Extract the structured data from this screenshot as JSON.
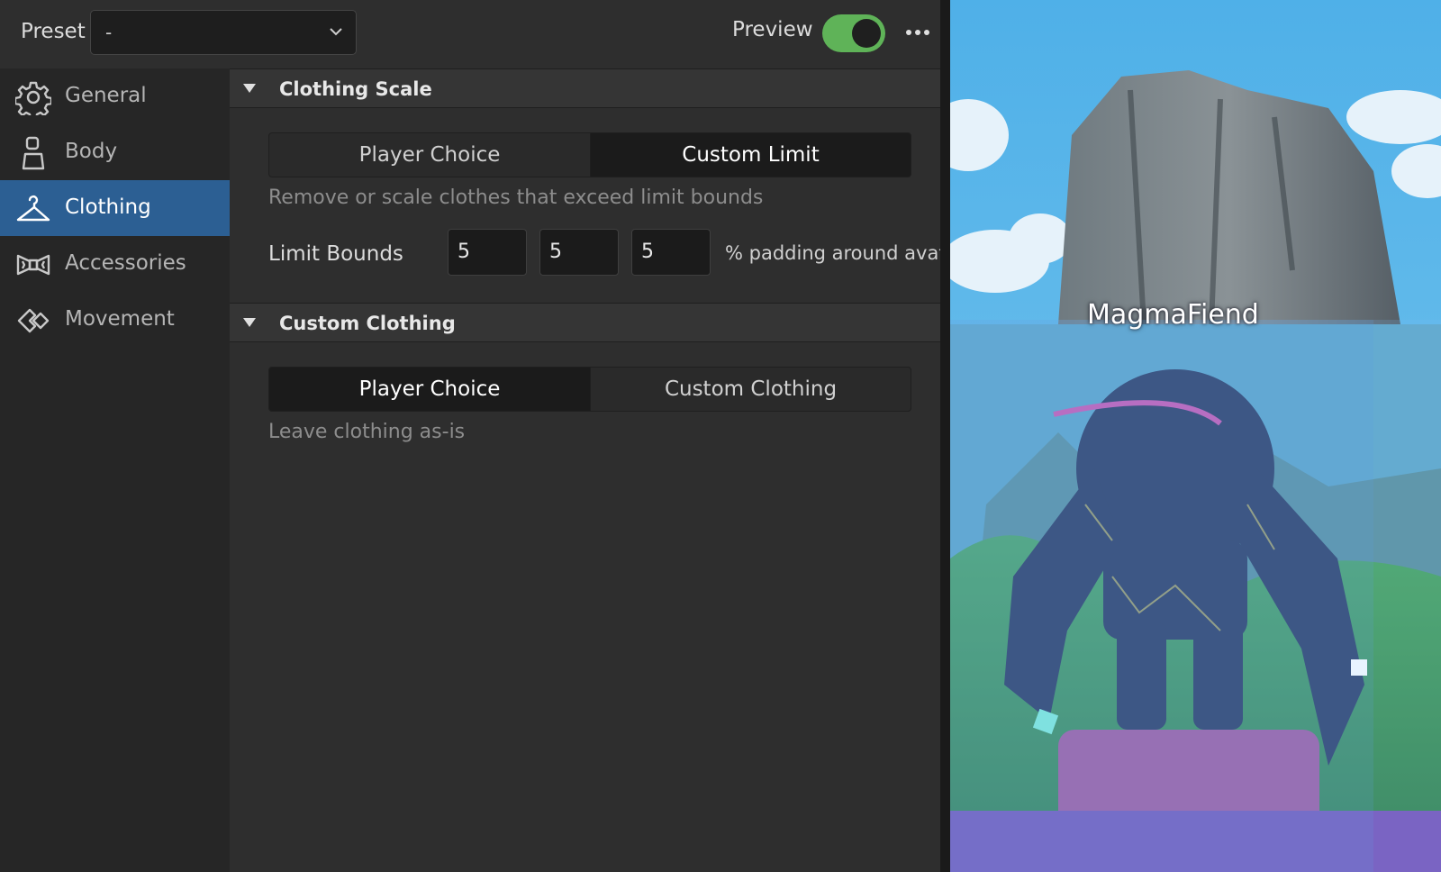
{
  "topbar": {
    "preset_label": "Preset",
    "preset_value": "-",
    "preview_label": "Preview",
    "preview_on": true
  },
  "sidebar": {
    "items": [
      {
        "label": "General",
        "icon": "gear-icon",
        "active": false
      },
      {
        "label": "Body",
        "icon": "body-icon",
        "active": false
      },
      {
        "label": "Clothing",
        "icon": "hanger-icon",
        "active": true
      },
      {
        "label": "Accessories",
        "icon": "bow-icon",
        "active": false
      },
      {
        "label": "Movement",
        "icon": "movement-icon",
        "active": false
      }
    ]
  },
  "clothing_scale": {
    "title": "Clothing Scale",
    "options": [
      "Player Choice",
      "Custom Limit"
    ],
    "selected": "Custom Limit",
    "description": "Remove or scale clothes that exceed limit bounds",
    "limit_label": "Limit Bounds",
    "limit_values": [
      "5",
      "5",
      "5"
    ],
    "padding_text": "% padding around avatar"
  },
  "custom_clothing": {
    "title": "Custom Clothing",
    "options": [
      "Player Choice",
      "Custom Clothing"
    ],
    "selected": "Player Choice",
    "description": "Leave clothing as-is"
  },
  "viewport": {
    "avatar_name": "MagmaFiend"
  },
  "colors": {
    "accent": "#2c5f93",
    "toggle_on": "#5fb358",
    "panel": "#2e2e2e",
    "sidebar": "#262626"
  }
}
